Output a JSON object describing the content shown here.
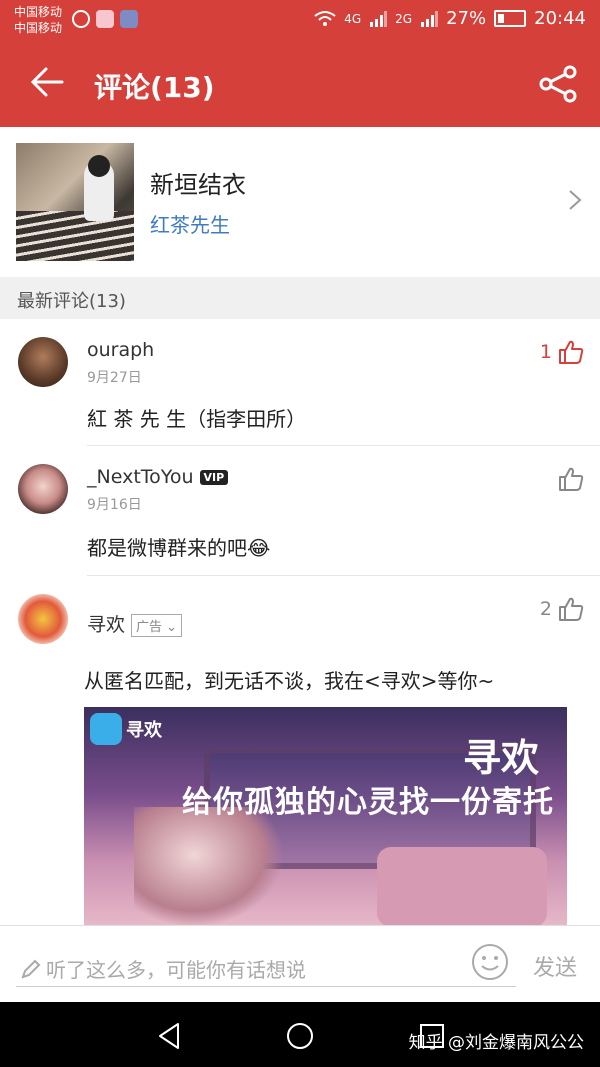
{
  "status_bar": {
    "carrier_1": "中国移动",
    "carrier_2": "中国移动",
    "signal_1": "4G",
    "signal_2": "2G",
    "battery": "27%",
    "time": "20:44"
  },
  "header": {
    "title": "评论(13)",
    "back_icon": "arrow-left-icon",
    "share_icon": "share-icon"
  },
  "article": {
    "title": "新垣结衣",
    "author": "红茶先生"
  },
  "section": {
    "label": "最新评论(13)"
  },
  "comments": [
    {
      "user": "ouraph",
      "date": "9月27日",
      "text": "紅 茶 先 生（指李田所）",
      "likes": "1"
    },
    {
      "user": "_NextToYou",
      "badge": "VIP",
      "date": "9月16日",
      "text": "都是微博群来的吧😂",
      "likes": ""
    },
    {
      "user": "寻欢",
      "tag": "广告",
      "text": "从匿名匹配，到无话不谈，我在<寻欢>等你~",
      "likes": "2"
    }
  ],
  "ad_banner": {
    "logo_text": "寻欢",
    "brand": "寻欢",
    "slogan": "给你孤独的心灵找一份寄托"
  },
  "input_bar": {
    "placeholder": "听了这么多，可能你有话想说",
    "send_label": "发送"
  },
  "nav_bar": {
    "watermark": "知乎 @刘金爆南风公公"
  },
  "colors": {
    "brand_red": "#d5403a",
    "link_blue": "#3e7bc1"
  }
}
